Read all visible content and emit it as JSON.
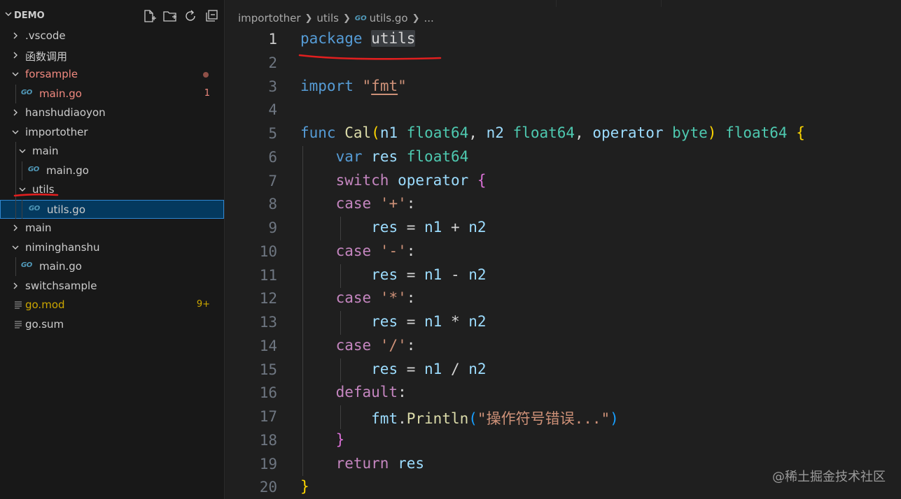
{
  "explorer": {
    "title": "DEMO",
    "header_icons": [
      "new-file-icon",
      "new-folder-icon",
      "refresh-icon",
      "collapse-all-icon"
    ],
    "items": [
      {
        "label": ".vscode",
        "kind": "folder",
        "expanded": false,
        "depth": 0
      },
      {
        "label": "函数调用",
        "kind": "folder",
        "expanded": false,
        "depth": 0
      },
      {
        "label": "forsample",
        "kind": "folder",
        "expanded": true,
        "depth": 0,
        "status": "error-dot"
      },
      {
        "label": "main.go",
        "kind": "go-file",
        "depth": 1,
        "status": "error",
        "badge": "1"
      },
      {
        "label": "hanshudiaoyon",
        "kind": "folder",
        "expanded": false,
        "depth": 0
      },
      {
        "label": "importother",
        "kind": "folder",
        "expanded": true,
        "depth": 0
      },
      {
        "label": "main",
        "kind": "folder",
        "expanded": true,
        "depth": 1
      },
      {
        "label": "main.go",
        "kind": "go-file",
        "depth": 2
      },
      {
        "label": "utils",
        "kind": "folder",
        "expanded": true,
        "depth": 1
      },
      {
        "label": "utils.go",
        "kind": "go-file",
        "depth": 2,
        "selected": true
      },
      {
        "label": "main",
        "kind": "folder",
        "expanded": false,
        "depth": 0
      },
      {
        "label": "niminghanshu",
        "kind": "folder",
        "expanded": true,
        "depth": 0
      },
      {
        "label": "main.go",
        "kind": "go-file",
        "depth": 1
      },
      {
        "label": "switchsample",
        "kind": "folder",
        "expanded": false,
        "depth": 0
      },
      {
        "label": "go.mod",
        "kind": "file",
        "depth": 0,
        "status": "warn",
        "badge": "9+"
      },
      {
        "label": "go.sum",
        "kind": "file",
        "depth": 0
      }
    ]
  },
  "breadcrumb": {
    "parts": [
      "importother",
      "utils",
      "utils.go",
      "..."
    ],
    "file_icon_text": "GO"
  },
  "editor": {
    "active_line": 1,
    "lines": [
      {
        "n": "1",
        "tokens": [
          [
            "kw",
            "package"
          ],
          [
            "plain",
            " "
          ],
          [
            "hl",
            "utils"
          ]
        ]
      },
      {
        "n": "2",
        "tokens": []
      },
      {
        "n": "3",
        "tokens": [
          [
            "kw",
            "import"
          ],
          [
            "plain",
            " "
          ],
          [
            "str",
            "\""
          ],
          [
            "strU",
            "fmt"
          ],
          [
            "str",
            "\""
          ]
        ]
      },
      {
        "n": "4",
        "tokens": []
      },
      {
        "n": "5",
        "tokens": [
          [
            "kw",
            "func"
          ],
          [
            "plain",
            " "
          ],
          [
            "fn",
            "Cal"
          ],
          [
            "b1",
            "("
          ],
          [
            "var",
            "n1"
          ],
          [
            "plain",
            " "
          ],
          [
            "type",
            "float64"
          ],
          [
            "plain",
            ", "
          ],
          [
            "var",
            "n2"
          ],
          [
            "plain",
            " "
          ],
          [
            "type",
            "float64"
          ],
          [
            "plain",
            ", "
          ],
          [
            "var",
            "operator"
          ],
          [
            "plain",
            " "
          ],
          [
            "type",
            "byte"
          ],
          [
            "b1",
            ")"
          ],
          [
            "plain",
            " "
          ],
          [
            "type",
            "float64"
          ],
          [
            "plain",
            " "
          ],
          [
            "b1",
            "{"
          ]
        ]
      },
      {
        "n": "6",
        "tokens": [
          [
            "plain",
            "    "
          ],
          [
            "kw",
            "var"
          ],
          [
            "plain",
            " "
          ],
          [
            "var",
            "res"
          ],
          [
            "plain",
            " "
          ],
          [
            "type",
            "float64"
          ]
        ]
      },
      {
        "n": "7",
        "tokens": [
          [
            "plain",
            "    "
          ],
          [
            "ctrl",
            "switch"
          ],
          [
            "plain",
            " "
          ],
          [
            "var",
            "operator"
          ],
          [
            "plain",
            " "
          ],
          [
            "b2",
            "{"
          ]
        ]
      },
      {
        "n": "8",
        "tokens": [
          [
            "plain",
            "    "
          ],
          [
            "ctrl",
            "case"
          ],
          [
            "plain",
            " "
          ],
          [
            "str",
            "'+'"
          ],
          [
            "plain",
            ":"
          ]
        ]
      },
      {
        "n": "9",
        "tokens": [
          [
            "plain",
            "        "
          ],
          [
            "var",
            "res"
          ],
          [
            "plain",
            " = "
          ],
          [
            "var",
            "n1"
          ],
          [
            "plain",
            " + "
          ],
          [
            "var",
            "n2"
          ]
        ]
      },
      {
        "n": "10",
        "tokens": [
          [
            "plain",
            "    "
          ],
          [
            "ctrl",
            "case"
          ],
          [
            "plain",
            " "
          ],
          [
            "str",
            "'-'"
          ],
          [
            "plain",
            ":"
          ]
        ]
      },
      {
        "n": "11",
        "tokens": [
          [
            "plain",
            "        "
          ],
          [
            "var",
            "res"
          ],
          [
            "plain",
            " = "
          ],
          [
            "var",
            "n1"
          ],
          [
            "plain",
            " - "
          ],
          [
            "var",
            "n2"
          ]
        ]
      },
      {
        "n": "12",
        "tokens": [
          [
            "plain",
            "    "
          ],
          [
            "ctrl",
            "case"
          ],
          [
            "plain",
            " "
          ],
          [
            "str",
            "'*'"
          ],
          [
            "plain",
            ":"
          ]
        ]
      },
      {
        "n": "13",
        "tokens": [
          [
            "plain",
            "        "
          ],
          [
            "var",
            "res"
          ],
          [
            "plain",
            " = "
          ],
          [
            "var",
            "n1"
          ],
          [
            "plain",
            " * "
          ],
          [
            "var",
            "n2"
          ]
        ]
      },
      {
        "n": "14",
        "tokens": [
          [
            "plain",
            "    "
          ],
          [
            "ctrl",
            "case"
          ],
          [
            "plain",
            " "
          ],
          [
            "str",
            "'/'"
          ],
          [
            "plain",
            ":"
          ]
        ]
      },
      {
        "n": "15",
        "tokens": [
          [
            "plain",
            "        "
          ],
          [
            "var",
            "res"
          ],
          [
            "plain",
            " = "
          ],
          [
            "var",
            "n1"
          ],
          [
            "plain",
            " / "
          ],
          [
            "var",
            "n2"
          ]
        ]
      },
      {
        "n": "16",
        "tokens": [
          [
            "plain",
            "    "
          ],
          [
            "ctrl",
            "default"
          ],
          [
            "plain",
            ":"
          ]
        ]
      },
      {
        "n": "17",
        "tokens": [
          [
            "plain",
            "        "
          ],
          [
            "var",
            "fmt"
          ],
          [
            "plain",
            "."
          ],
          [
            "fn",
            "Println"
          ],
          [
            "b3",
            "("
          ],
          [
            "str",
            "\"操作符号错误...\""
          ],
          [
            "b3",
            ")"
          ]
        ]
      },
      {
        "n": "18",
        "tokens": [
          [
            "plain",
            "    "
          ],
          [
            "b2",
            "}"
          ]
        ]
      },
      {
        "n": "19",
        "tokens": [
          [
            "plain",
            "    "
          ],
          [
            "ctrl",
            "return"
          ],
          [
            "plain",
            " "
          ],
          [
            "var",
            "res"
          ]
        ]
      },
      {
        "n": "20",
        "tokens": [
          [
            "b1",
            "}"
          ]
        ]
      }
    ]
  },
  "watermark": "@稀土掘金技术社区",
  "colors": {
    "error": "#f1897f",
    "warn": "#cca700",
    "annotation_red": "#e11f1f",
    "selection_border": "#2f87d2"
  }
}
